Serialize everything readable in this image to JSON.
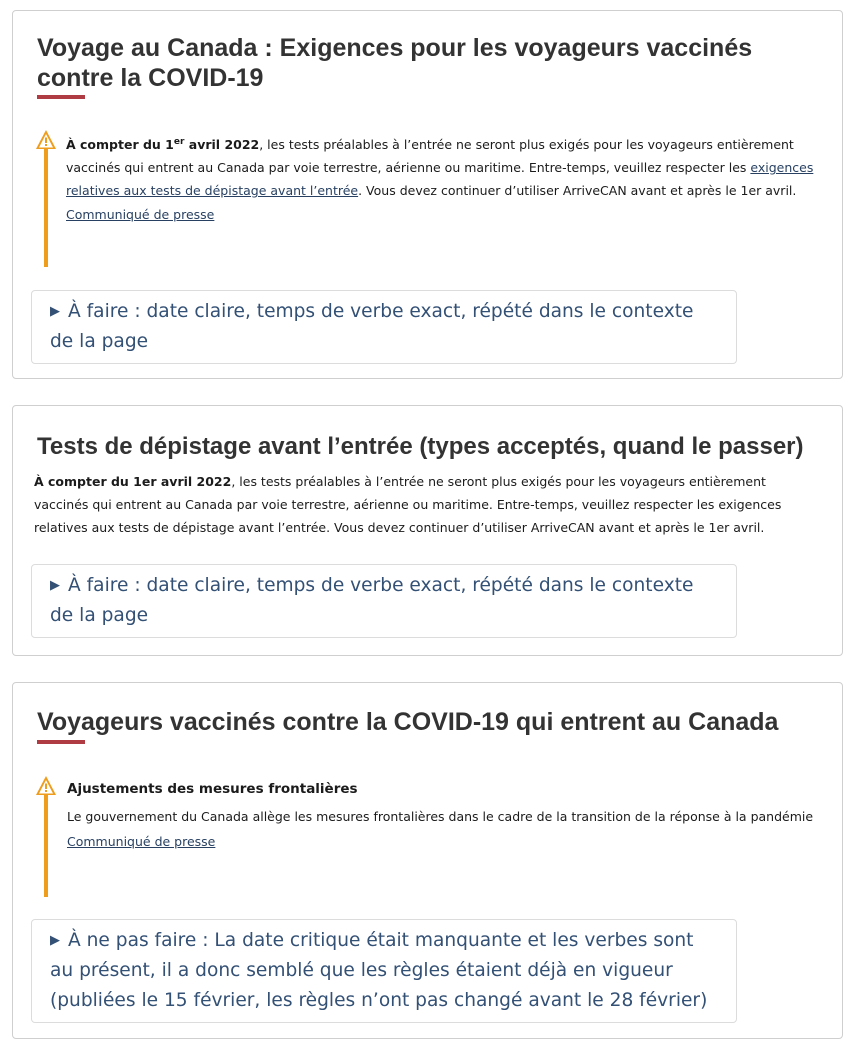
{
  "card1": {
    "title": "Voyage au Canada : Exigences pour les voyageurs vaccinés contre la COVID-19",
    "alert": {
      "lead_a": "À compter du 1",
      "lead_sup": "er",
      "lead_b": " avril 2022",
      "text_a": ", les tests préalables à l’entrée ne seront plus exigés pour les voyageurs entièrement vaccinés qui entrent au Canada par voie terrestre, aérienne ou maritime. Entre-temps, veuillez respecter les ",
      "link": "exigences relatives aux tests de dépistage avant l’entrée",
      "text_b": ". Vous devez continuer d’utiliser ArriveCAN avant et après le 1er avril.",
      "press_link": "Communiqué de presse"
    },
    "details": "À faire : date claire, temps de verbe exact, répété dans le contexte de la page"
  },
  "card2": {
    "title": "Tests de dépistage avant l’entrée (types acceptés, quand le passer)",
    "lead": "À compter du 1er avril 2022",
    "text": ", les tests préalables à l’entrée ne seront plus exigés pour les voyageurs entièrement vaccinés qui entrent au Canada par voie terrestre, aérienne ou maritime. Entre-temps, veuillez respecter les exigences relatives aux tests de dépistage avant l’entrée. Vous devez continuer d’utiliser ArriveCAN avant et après le 1er avril.",
    "details": "À faire : date claire, temps de verbe exact, répété dans le contexte de la page"
  },
  "card3": {
    "title": "Voyageurs vaccinés contre la COVID-19 qui entrent au Canada",
    "alert": {
      "heading": "Ajustements des mesures frontalières",
      "text": "Le gouvernement du Canada allège les mesures frontalières dans le cadre de la transition de la réponse à la pandémie",
      "press_link": "Communiqué de presse"
    },
    "details": "À ne pas faire : La date critique était manquante et les verbes sont au présent, il a donc semblé que les règles étaient déjà en vigueur (publiées le 15 février, les règles n’ont pas changé avant le 28 février)"
  },
  "colors": {
    "accent_red": "#af3c43",
    "warning_orange": "#ee9d1d",
    "link_blue": "#284162",
    "details_text": "#335075"
  },
  "icons": {
    "alert": "warning-triangle-icon",
    "details": "triangle-right-icon"
  }
}
